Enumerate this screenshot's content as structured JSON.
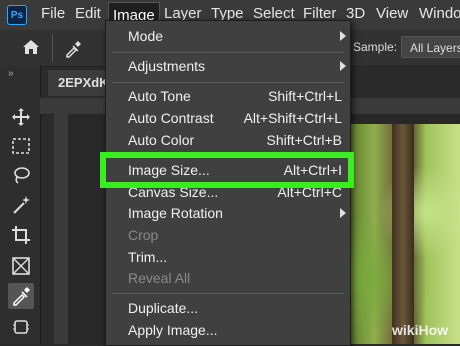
{
  "app": {
    "logo_text": "Ps"
  },
  "menubar": {
    "items": [
      "File",
      "Edit",
      "Image",
      "Layer",
      "Type",
      "Select",
      "Filter",
      "3D",
      "View",
      "Windo"
    ],
    "active": "Image"
  },
  "options_bar": {
    "sample_label": "Sample:",
    "sample_value": "All Layers"
  },
  "toolbar": {
    "collapse": "»",
    "tools": [
      "move-tool",
      "marquee-tool",
      "lasso-tool",
      "magic-wand-tool",
      "crop-tool",
      "frame-tool",
      "eyedropper-tool",
      "patch-tool"
    ],
    "active": "eyedropper-tool"
  },
  "document": {
    "tab_label": "2EPXdK"
  },
  "image_menu": {
    "items": [
      {
        "label": "Mode",
        "shortcut": "",
        "submenu": true,
        "disabled": false
      },
      {
        "label": "Adjustments",
        "shortcut": "",
        "submenu": true,
        "disabled": false
      },
      {
        "label": "Auto Tone",
        "shortcut": "Shift+Ctrl+L",
        "submenu": false,
        "disabled": false
      },
      {
        "label": "Auto Contrast",
        "shortcut": "Alt+Shift+Ctrl+L",
        "submenu": false,
        "disabled": false
      },
      {
        "label": "Auto Color",
        "shortcut": "Shift+Ctrl+B",
        "submenu": false,
        "disabled": false
      },
      {
        "label": "Image Size...",
        "shortcut": "Alt+Ctrl+I",
        "submenu": false,
        "disabled": false
      },
      {
        "label": "Canvas Size...",
        "shortcut": "Alt+Ctrl+C",
        "submenu": false,
        "disabled": false
      },
      {
        "label": "Image Rotation",
        "shortcut": "",
        "submenu": true,
        "disabled": false
      },
      {
        "label": "Crop",
        "shortcut": "",
        "submenu": false,
        "disabled": true
      },
      {
        "label": "Trim...",
        "shortcut": "",
        "submenu": false,
        "disabled": false
      },
      {
        "label": "Reveal All",
        "shortcut": "",
        "submenu": false,
        "disabled": true
      },
      {
        "label": "Duplicate...",
        "shortcut": "",
        "submenu": false,
        "disabled": false
      },
      {
        "label": "Apply Image...",
        "shortcut": "",
        "submenu": false,
        "disabled": false
      }
    ],
    "highlighted": "Image Size...",
    "highlight_color": "#39ee1f"
  },
  "watermark": {
    "wiki": "wiki",
    "how": "How"
  }
}
